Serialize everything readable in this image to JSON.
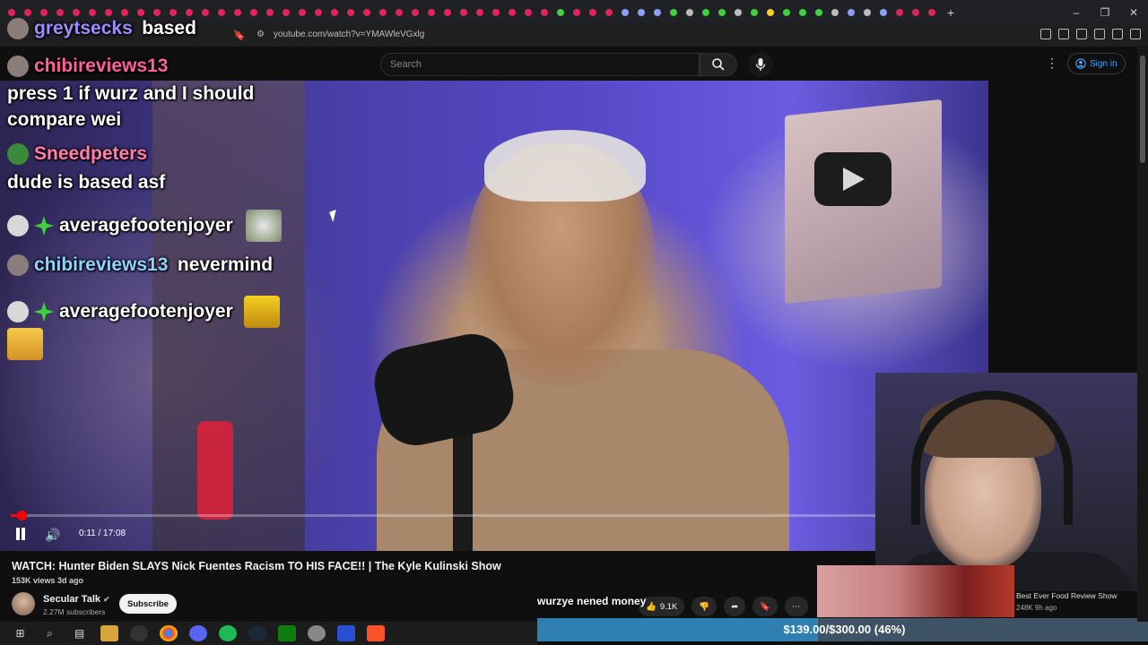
{
  "browser": {
    "url": "youtube.com/watch?v=YMAWleVGxlg"
  },
  "youtube": {
    "search_placeholder": "Search",
    "signin_label": "Sign in",
    "more_icon": "kebab-icon"
  },
  "chat": [
    {
      "user": "greytsecks",
      "user_color": "#9b8cff",
      "message": "based",
      "badge": "",
      "avatar": true
    },
    {
      "user": "chibireviews13",
      "user_color": "#ff5f9a",
      "message": "",
      "badge": "",
      "avatar": true
    },
    {
      "user": "",
      "user_color": "#ffffff",
      "message": "press 1 if wurz and I should",
      "badge": "",
      "avatar": false
    },
    {
      "user": "",
      "user_color": "#ffffff",
      "message": "compare wei",
      "badge": "",
      "avatar": false
    },
    {
      "user": "Sneedpeters",
      "user_color": "#ff7fa8",
      "message": "",
      "badge": "",
      "avatar": true
    },
    {
      "user": "",
      "user_color": "#ffffff",
      "message": "dude is based asf",
      "badge": "",
      "avatar": false
    },
    {
      "user": "averagefootenjoyer",
      "user_color": "#ffffff",
      "message": "",
      "badge": "star",
      "avatar": true
    },
    {
      "user": "chibireviews13",
      "user_color": "#8fd3ff",
      "message": "nevermind",
      "badge": "",
      "avatar": true
    },
    {
      "user": "averagefootenjoyer",
      "user_color": "#ffffff",
      "message": "",
      "badge": "star",
      "avatar": true
    }
  ],
  "player": {
    "time": "0:11 / 17:08",
    "progress": 0.011
  },
  "video": {
    "title": "WATCH: Hunter Biden SLAYS Nick Fuentes Racism TO HIS FACE!! | The Kyle Kulinski Show",
    "views": "153K views  3d ago",
    "channel": "Secular Talk",
    "subscribers": "2.27M subscribers",
    "subscribe_label": "Subscribe",
    "likes": "9.1K"
  },
  "overlay": {
    "message": "wurzye nened money",
    "goal_text": "$139.00/$300.00 (46%)",
    "goal_fraction": 0.46
  },
  "recommended": {
    "title": "Best Ever Food Review Show",
    "meta": "248K  9h ago"
  }
}
